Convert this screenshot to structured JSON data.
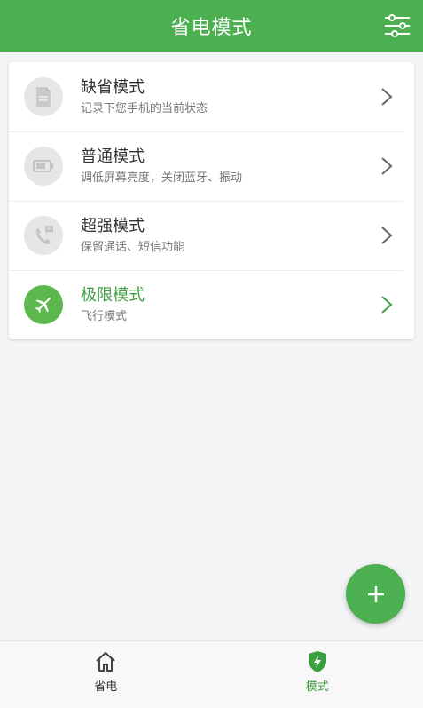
{
  "header": {
    "title": "省电模式",
    "settings_icon": "sliders-icon"
  },
  "colors": {
    "accent": "#4caf50",
    "active_text": "#43a047"
  },
  "modes": [
    {
      "title": "缺省模式",
      "subtitle": "记录下您手机的当前状态",
      "icon": "document-icon",
      "active": false
    },
    {
      "title": "普通模式",
      "subtitle": "调低屏幕亮度，关闭蓝牙、振动",
      "icon": "battery-icon",
      "active": false
    },
    {
      "title": "超强模式",
      "subtitle": "保留通话、短信功能",
      "icon": "phone-message-icon",
      "active": false
    },
    {
      "title": "极限模式",
      "subtitle": "飞行模式",
      "icon": "airplane-icon",
      "active": true
    }
  ],
  "fab": {
    "label": "+",
    "icon": "plus-icon"
  },
  "bottom_nav": [
    {
      "label": "省电",
      "icon": "home-icon",
      "active": false
    },
    {
      "label": "模式",
      "icon": "shield-bolt-icon",
      "active": true
    }
  ]
}
